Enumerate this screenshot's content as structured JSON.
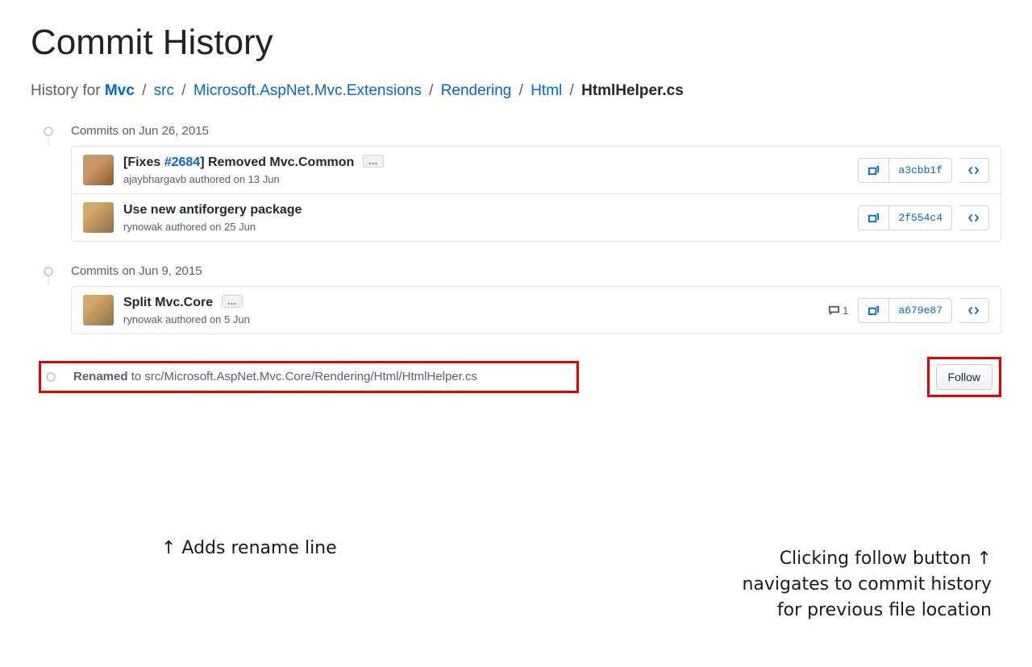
{
  "title": "Commit History",
  "breadcrumb": {
    "prefix": "History for ",
    "parts": [
      "Mvc",
      "src",
      "Microsoft.AspNet.Mvc.Extensions",
      "Rendering",
      "Html"
    ],
    "final": "HtmlHelper.cs"
  },
  "groups": [
    {
      "heading": "Commits on Jun 26, 2015",
      "commits": [
        {
          "title_pre": "[Fixes ",
          "issue": "#2684",
          "title_post": "] Removed Mvc.Common",
          "has_ellipsis": true,
          "author": "ajaybhargavb",
          "auth_rest": " authored on 13 Jun",
          "sha": "a3cbb1f",
          "comments": null,
          "avatar": "a1"
        },
        {
          "title_pre": "Use new antiforgery package",
          "issue": "",
          "title_post": "",
          "has_ellipsis": false,
          "author": "rynowak",
          "auth_rest": " authored on 25 Jun",
          "sha": "2f554c4",
          "comments": null,
          "avatar": "a2"
        }
      ]
    },
    {
      "heading": "Commits on Jun 9, 2015",
      "commits": [
        {
          "title_pre": "Split Mvc.Core",
          "issue": "",
          "title_post": "",
          "has_ellipsis": true,
          "author": "rynowak",
          "auth_rest": " authored on 5 Jun",
          "sha": "a679e87",
          "comments": "1",
          "avatar": "a2"
        }
      ]
    }
  ],
  "rename": {
    "label": "Renamed",
    "rest": " to src/Microsoft.AspNet.Mvc.Core/Rendering/Html/HtmlHelper.cs"
  },
  "follow_label": "Follow",
  "annotations": {
    "left": "↑ Adds rename line",
    "right_l1": "Clicking follow button ↑",
    "right_l2": "navigates to commit history",
    "right_l3": "for previous file location"
  }
}
